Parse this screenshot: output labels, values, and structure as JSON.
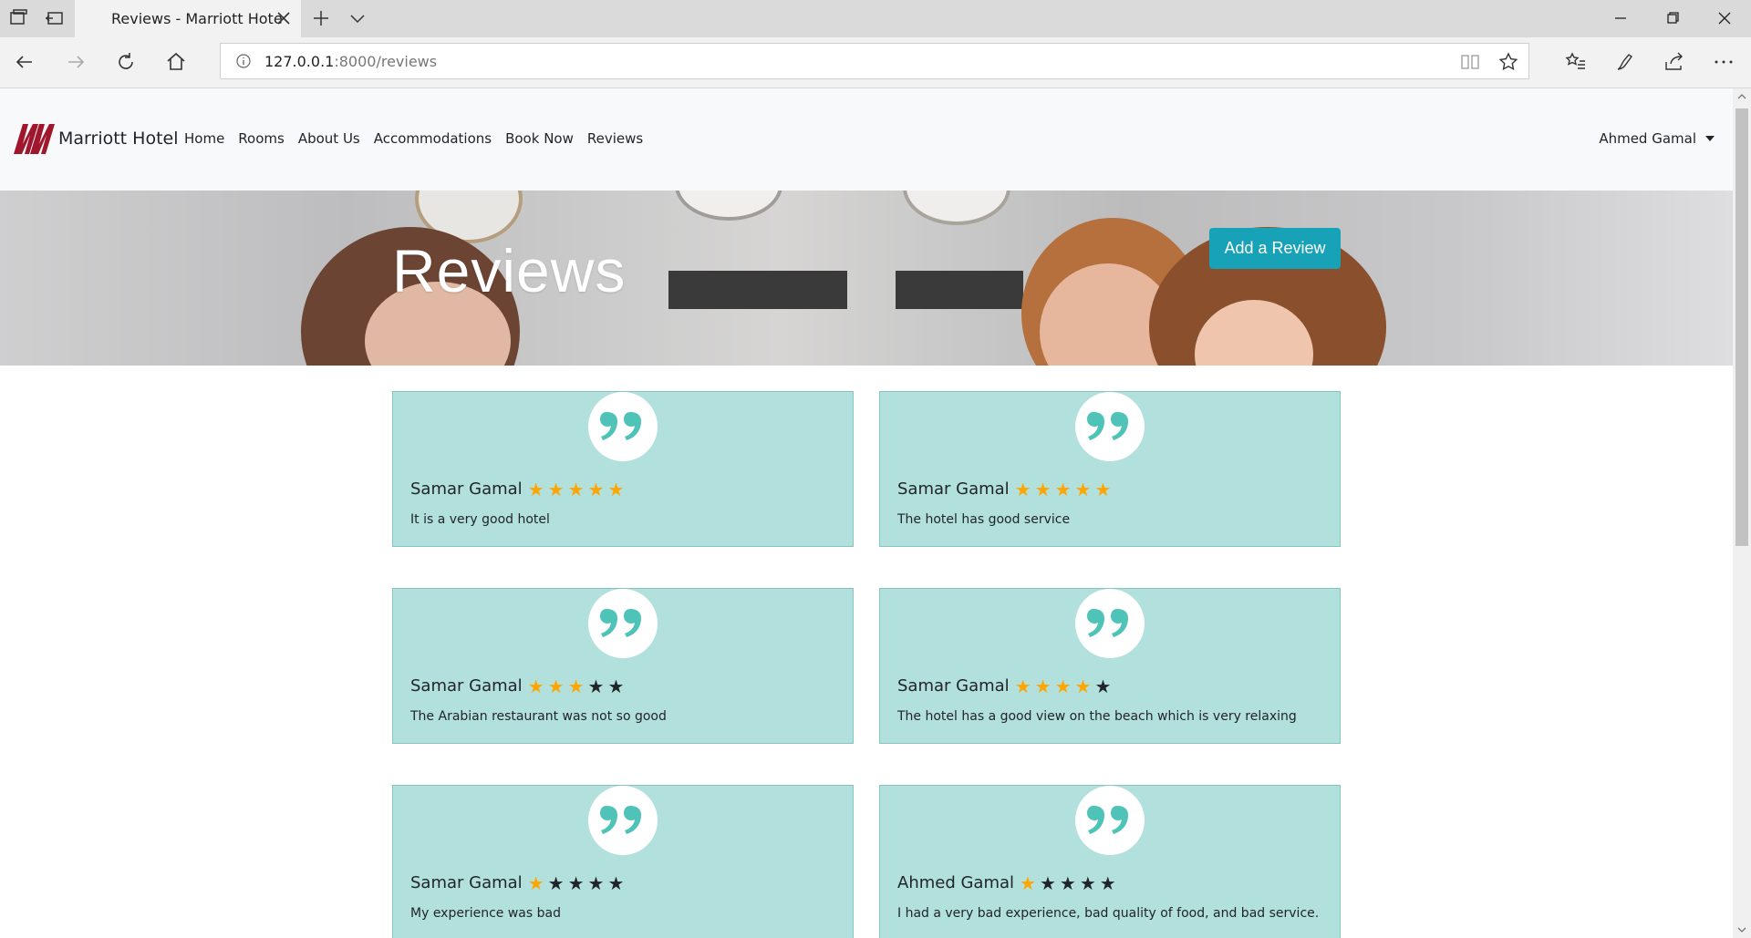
{
  "browser": {
    "tab_title": "Reviews - Marriott Hote",
    "url_host": "127.0.0.1",
    "url_rest": ":8000/reviews"
  },
  "navbar": {
    "brand": "Marriott Hotel",
    "links": [
      "Home",
      "Rooms",
      "About Us",
      "Accommodations",
      "Book Now",
      "Reviews"
    ],
    "user": "Ahmed Gamal"
  },
  "hero": {
    "title": "Reviews",
    "add_button": "Add a Review"
  },
  "colors": {
    "accent": "#17a2b8",
    "card_bg": "#b2e0dd",
    "quote": "#4fc3b8",
    "star_on": "#ffa500",
    "star_off": "#212529",
    "brand_logo": "#a0162d"
  },
  "reviews": [
    {
      "name": "Samar Gamal",
      "rating": 5,
      "text": "It is a very good hotel"
    },
    {
      "name": "Samar Gamal",
      "rating": 5,
      "text": "The hotel has good service"
    },
    {
      "name": "Samar Gamal",
      "rating": 3,
      "text": "The Arabian restaurant was not so good"
    },
    {
      "name": "Samar Gamal",
      "rating": 4,
      "text": "The hotel has a good view on the beach which is very relaxing"
    },
    {
      "name": "Samar Gamal",
      "rating": 1,
      "text": "My experience was bad"
    },
    {
      "name": "Ahmed Gamal",
      "rating": 1,
      "text": "I had a very bad experience, bad quality of food, and bad service."
    }
  ]
}
